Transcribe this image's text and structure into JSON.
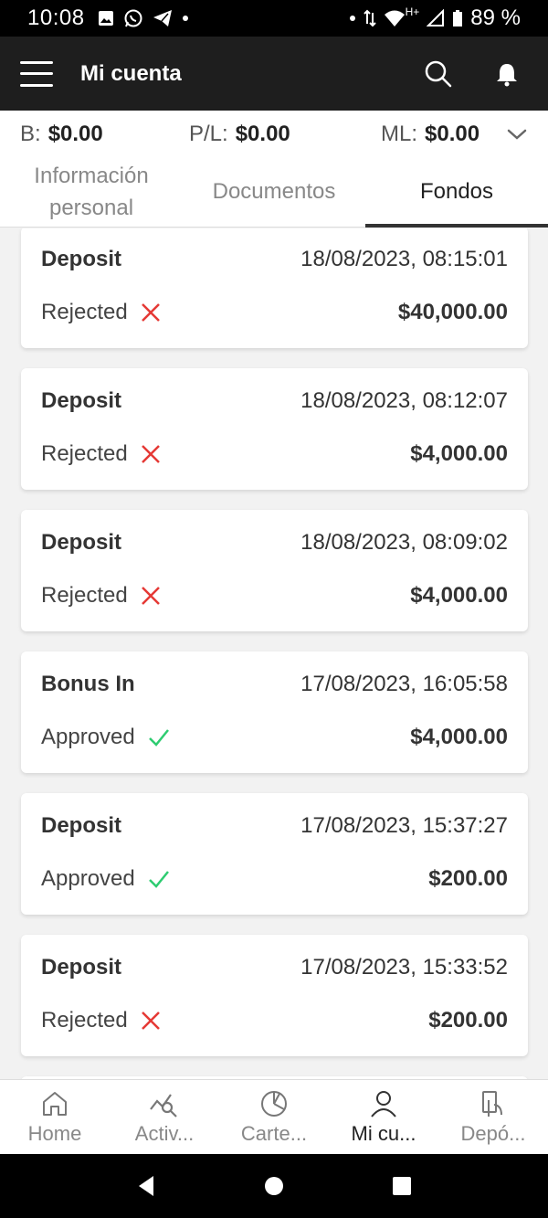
{
  "status_bar": {
    "time": "10:08",
    "battery": "89 %",
    "network": "H+"
  },
  "app_bar": {
    "title": "Mi cuenta"
  },
  "summary": {
    "balance_label": "B:",
    "balance_value": "$0.00",
    "pl_label": "P/L:",
    "pl_value": "$0.00",
    "ml_label": "ML:",
    "ml_value": "$0.00"
  },
  "tabs": [
    {
      "label": "Información personal",
      "active": false
    },
    {
      "label": "Documentos",
      "active": false
    },
    {
      "label": "Fondos",
      "active": true
    }
  ],
  "transactions": [
    {
      "type": "Deposit",
      "date": "18/08/2023, 08:15:01",
      "status": "Rejected",
      "amount": "$40,000.00"
    },
    {
      "type": "Deposit",
      "date": "18/08/2023, 08:12:07",
      "status": "Rejected",
      "amount": "$4,000.00"
    },
    {
      "type": "Deposit",
      "date": "18/08/2023, 08:09:02",
      "status": "Rejected",
      "amount": "$4,000.00"
    },
    {
      "type": "Bonus In",
      "date": "17/08/2023, 16:05:58",
      "status": "Approved",
      "amount": "$4,000.00"
    },
    {
      "type": "Deposit",
      "date": "17/08/2023, 15:37:27",
      "status": "Approved",
      "amount": "$200.00"
    },
    {
      "type": "Deposit",
      "date": "17/08/2023, 15:33:52",
      "status": "Rejected",
      "amount": "$200.00"
    }
  ],
  "bottom_nav": [
    {
      "label": "Home",
      "icon": "home-icon",
      "active": false
    },
    {
      "label": "Activ...",
      "icon": "assets-chart-icon",
      "active": false
    },
    {
      "label": "Carte...",
      "icon": "portfolio-pie-icon",
      "active": false
    },
    {
      "label": "Mi cu...",
      "icon": "user-icon",
      "active": true
    },
    {
      "label": "Depó...",
      "icon": "deposit-icon",
      "active": false
    }
  ],
  "colors": {
    "rejected": "#e53935",
    "approved": "#2ecc71",
    "app_bar": "#1e1e1e"
  }
}
